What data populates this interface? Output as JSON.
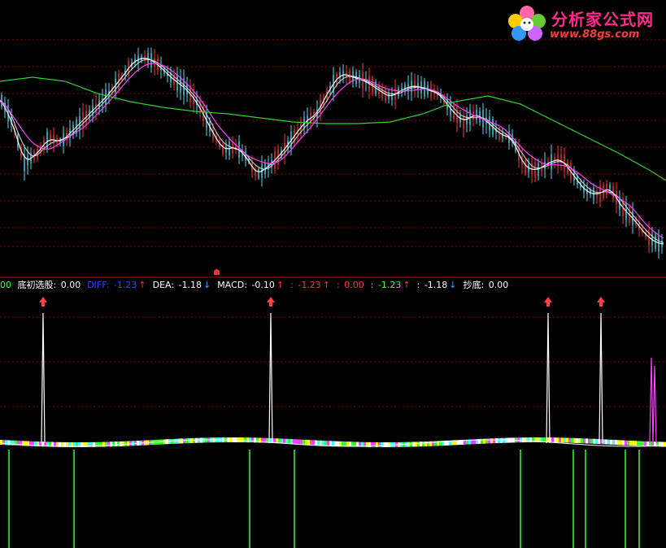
{
  "logo": {
    "title": "分析家公式网",
    "url": "www.88gs.com"
  },
  "indicator_header": {
    "prefix": "00",
    "items": [
      {
        "label": "底初选股:",
        "value": "0.00",
        "arrow": "",
        "label_color": "#ffffff",
        "value_color": "#ffffff"
      },
      {
        "label": "DIFF:",
        "value": "-1.23",
        "arrow": "↑",
        "label_color": "#3344ff",
        "value_color": "#3344ff"
      },
      {
        "label": "DEA:",
        "value": "-1.18",
        "arrow": "↓",
        "label_color": "#ffffff",
        "value_color": "#ffffff"
      },
      {
        "label": "MACD:",
        "value": "-0.10",
        "arrow": "↑",
        "label_color": "#ffffff",
        "value_color": "#ffffff"
      },
      {
        "label": ":",
        "value": "-1.23",
        "arrow": "↑",
        "label_color": "#ff3333",
        "value_color": "#ff3333"
      },
      {
        "label": ":",
        "value": "0.00",
        "arrow": "",
        "label_color": "#ff3333",
        "value_color": "#ff3333"
      },
      {
        "label": ":",
        "value": "-1.23",
        "arrow": "↑",
        "label_color": "#33ff33",
        "value_color": "#33ff33"
      },
      {
        "label": ":",
        "value": "-1.18",
        "arrow": "↓",
        "label_color": "#ffffff",
        "value_color": "#ffffff"
      },
      {
        "label": "抄底:",
        "value": "0.00",
        "arrow": "",
        "label_color": "#ffffff",
        "value_color": "#ffffff"
      }
    ]
  },
  "colors": {
    "background": "#000000",
    "grid": "#8b0000",
    "divider": "#c00000",
    "candle_up": "#ff3030",
    "candle_down": "#40e0ff",
    "ma_short": "#ffffff",
    "ma_mid": "#ff40ff",
    "ma_long": "#30d030",
    "signal_spike": "#ffffff",
    "signal_arrow": "#ff4040",
    "green_bars": "#30ff30"
  },
  "chart_data": {
    "type": "candlestick",
    "price_ma_long": [
      0.0,
      0.05,
      0.1,
      0.12,
      0.14,
      0.16,
      0.18,
      0.2,
      0.24,
      0.3,
      0.38,
      0.44,
      0.49,
      0.52,
      0.5,
      0.47,
      0.44,
      0.42,
      0.42,
      0.44,
      0.47,
      0.48,
      0.46,
      0.41,
      0.33,
      0.24,
      0.14,
      0.06
    ],
    "buy_signal_bars": [
      53,
      333,
      674,
      739
    ],
    "signal_arrows": [
      53,
      333,
      674,
      739
    ],
    "bottom_markers": [
      11,
      91,
      307,
      362,
      640,
      705,
      720,
      769,
      786
    ]
  },
  "axis_marker": "☗"
}
